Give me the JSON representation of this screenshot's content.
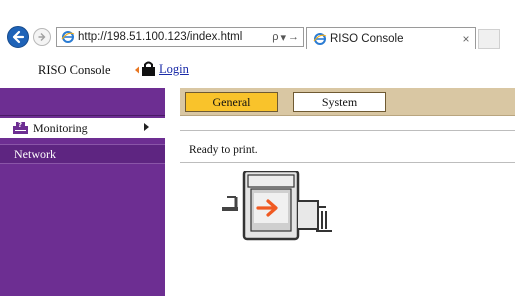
{
  "browser": {
    "url": "http://198.51.100.123/index.html",
    "search_glyph": "ρ",
    "dropdown_glyph": "▾",
    "refresh_glyph": "→",
    "tab_title": "RISO Console",
    "tab_close": "×",
    "icons": {
      "back": "back-arrow-icon",
      "forward": "forward-arrow-icon",
      "page": "ie-page-icon"
    }
  },
  "header": {
    "title": "RISO Console",
    "login_label": "Login",
    "login_icon": "lock-icon"
  },
  "sidebar": {
    "items": [
      {
        "label": "Monitoring",
        "icon": "printer-question-icon",
        "active": true
      },
      {
        "label": "Network",
        "active": false
      }
    ],
    "colors": {
      "background": "#6d2e92",
      "active_background": "#ffffff"
    }
  },
  "main": {
    "tabs": [
      {
        "label": "General",
        "selected": true
      },
      {
        "label": "System",
        "selected": false
      }
    ],
    "status_text": "Ready to print.",
    "printer_icon": "printer-status-icon",
    "colors": {
      "tabbar": "#d9c7a3",
      "selected_tab": "#f9c32b",
      "arrow": "#f05a22"
    }
  }
}
